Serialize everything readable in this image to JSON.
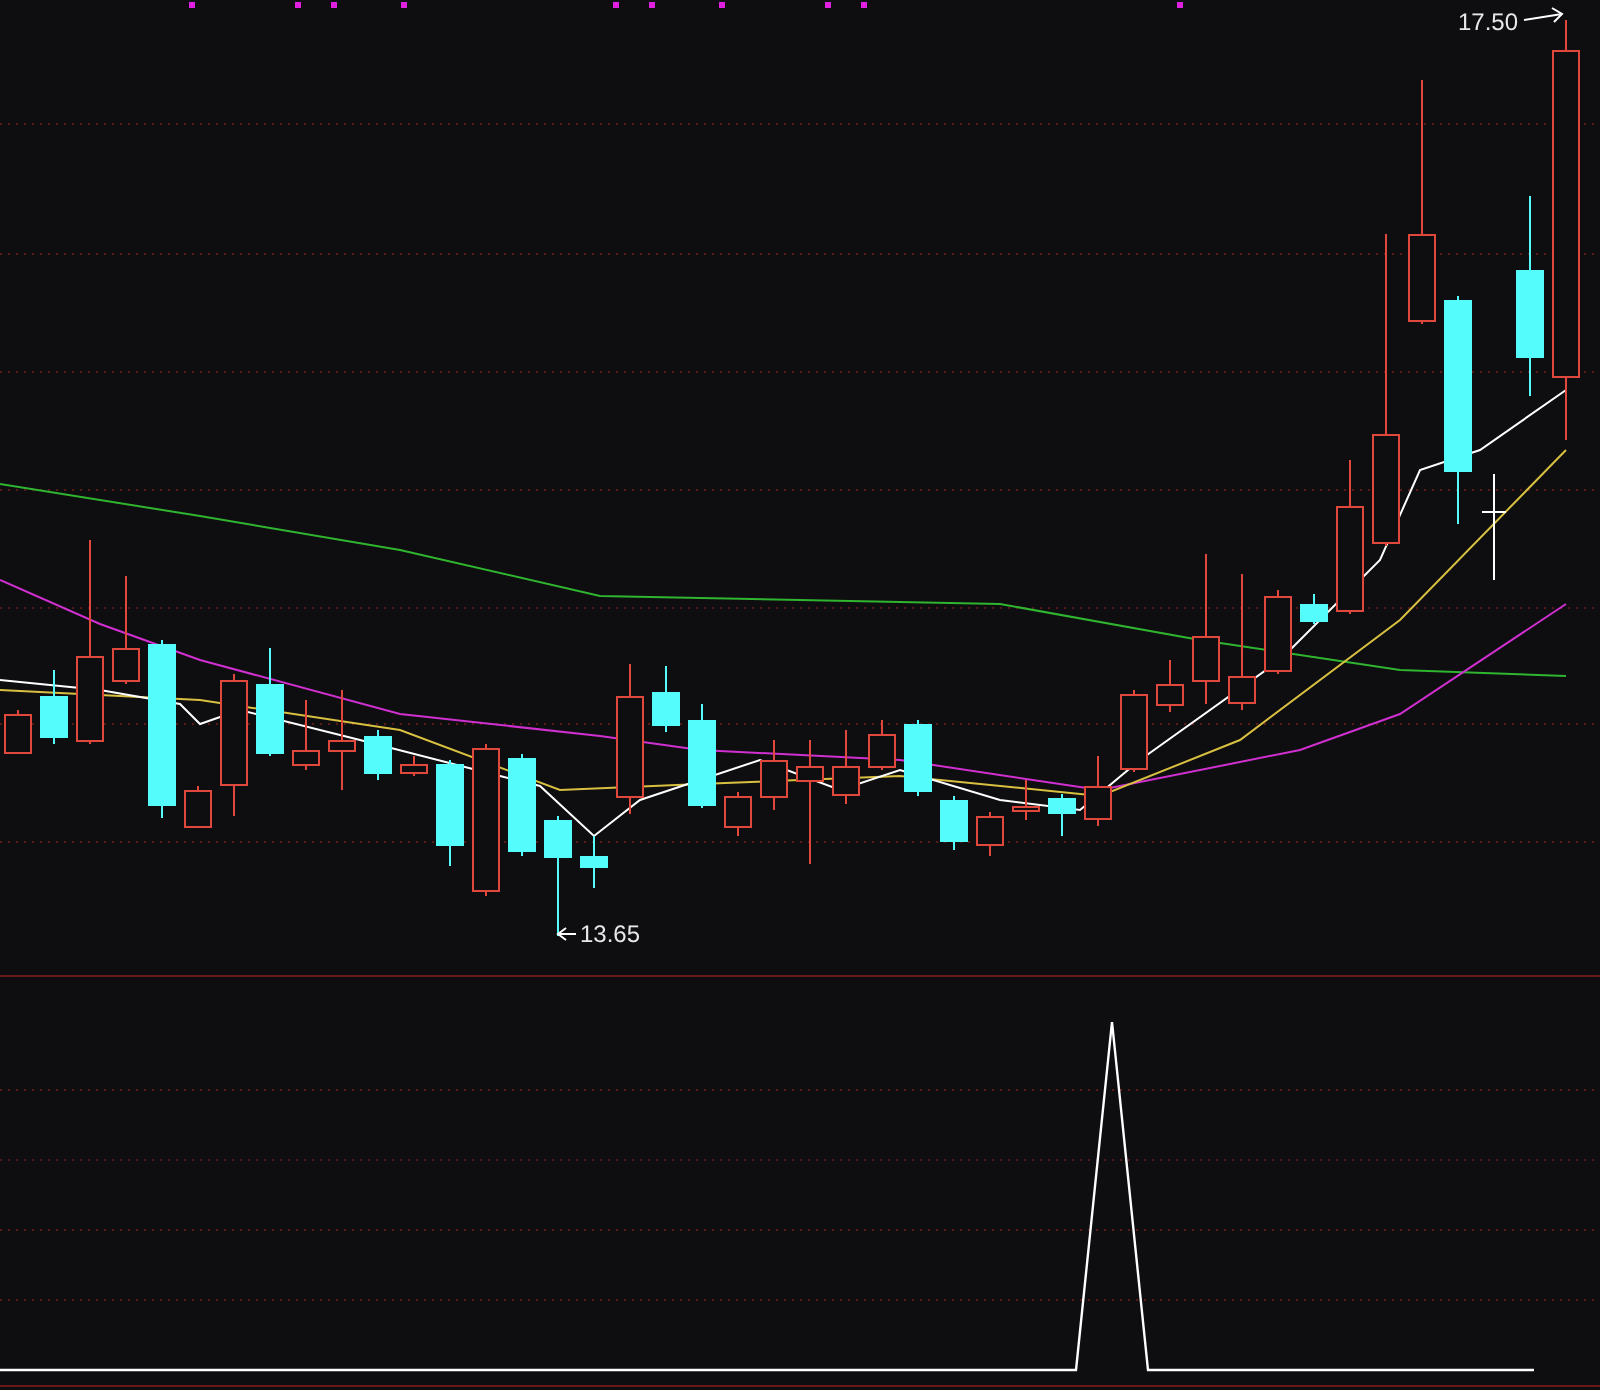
{
  "chart": {
    "high_label": "17.50",
    "low_label": "13.65"
  }
}
